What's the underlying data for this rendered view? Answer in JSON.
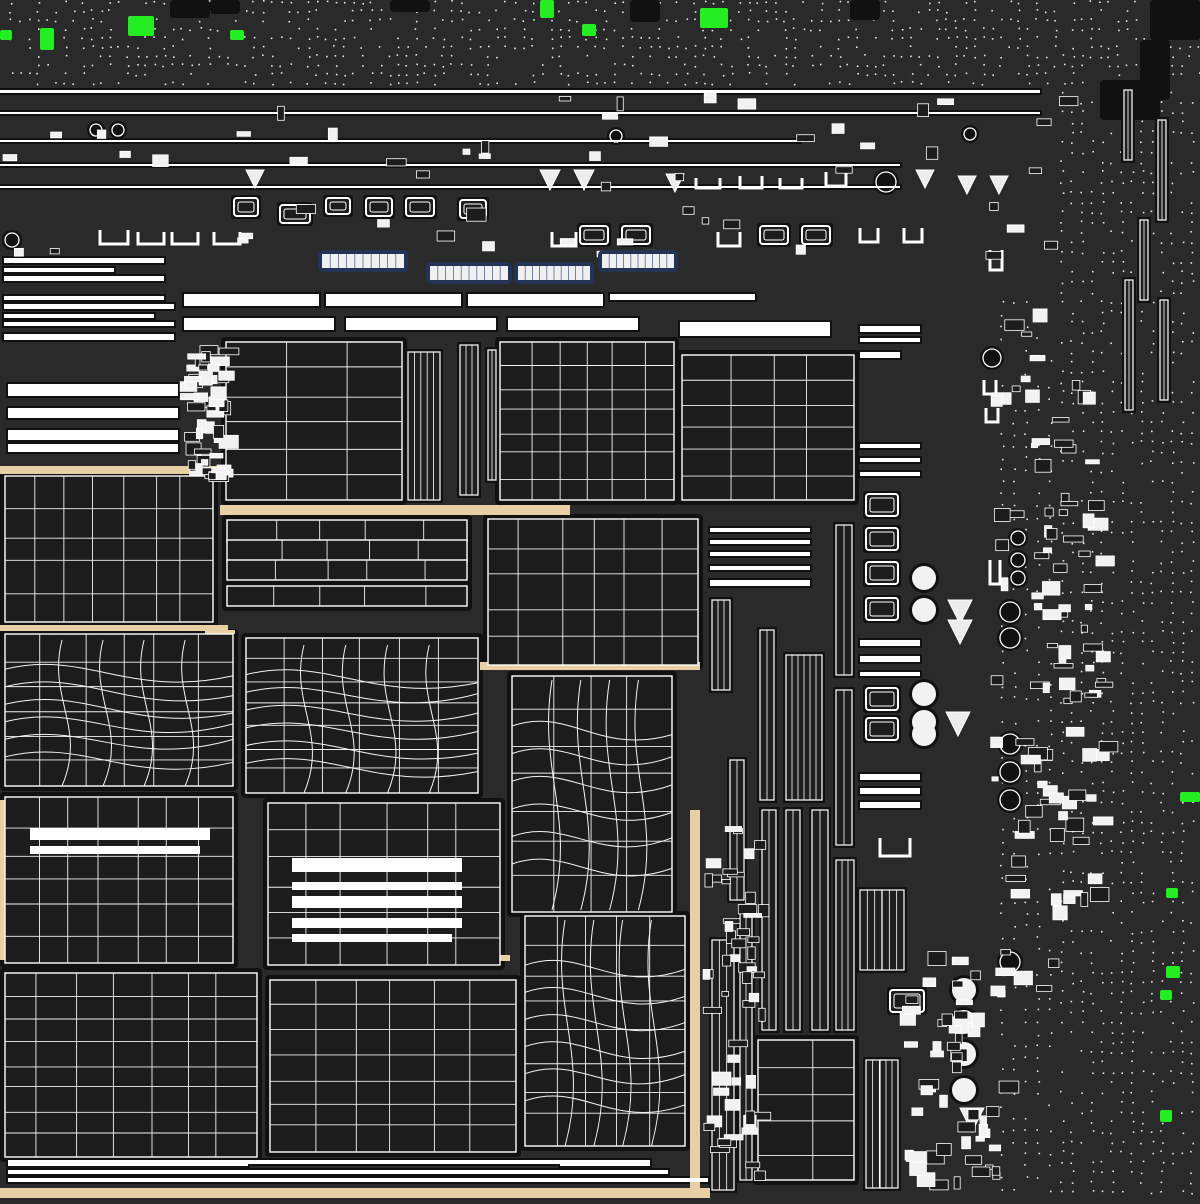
{
  "view": {
    "type": "uv-layout",
    "label": "",
    "background_color": "#2a2a2a",
    "wire_color": "#ffffff",
    "island_fill_color": "#1c1c1c",
    "padding_color": "#111111",
    "wood_seam_color": "#e9cfa6",
    "selection_color": "#22ee22",
    "selection_accent_color": "#233456"
  }
}
